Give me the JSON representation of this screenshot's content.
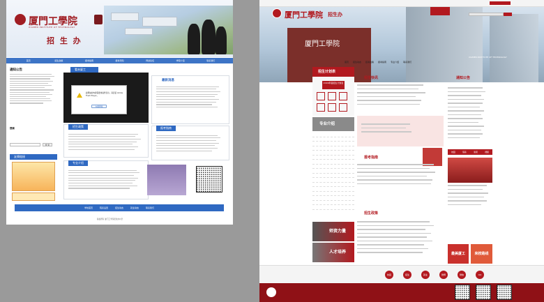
{
  "old_site": {
    "logo_text": "厦門工學院",
    "logo_english": "XIAMEN INSTITUTE OF TECHNOLOGY",
    "banner_subtitle": "招 生 办",
    "nav": [
      "首页",
      "招生政策",
      "报考指南",
      "报考须知",
      "师资队伍",
      "学院介绍",
      "联系我们"
    ],
    "notice_title": "通知公告",
    "featured_title": "最新消息",
    "campus_tab": "看未厦工",
    "dialog_text": "此网站的内容需要用插件显示，请安装 Adobe Flash Player。",
    "dialog_button": "立即安装",
    "search_label": "搜索",
    "search_button": "搜 索",
    "links_title": "友情链接",
    "policy_tab": "招生政策",
    "major_tab": "专业介绍",
    "guide_tab": "报考指南",
    "footer_links": [
      "学校首页",
      "院系设置",
      "招生动态",
      "就业动态",
      "联系我们"
    ],
    "copyright": "版权所有 厦门工学院招生办公室"
  },
  "new_site": {
    "logo_text": "厦門工學院",
    "logo_subtitle": "招生办",
    "hero_caption": "XIAMEN INSTITUTE OF TECHNOLOGY",
    "nav": [
      "首页",
      "招生动态",
      "招考政策",
      "报考指南",
      "专业介绍",
      "联系我们"
    ],
    "plan_title": "招生计划表",
    "plan_card": "2019年度招生计划表",
    "news_title": "招生快讯",
    "notice_title": "通知公告",
    "major_title": "专业介绍",
    "guide_title": "报考指南",
    "policy_title": "招生政策",
    "faculty_card": "师资力量",
    "talent_card": "人才培养",
    "right_tabs": [
      "校园",
      "院系",
      "新闻",
      "视频"
    ],
    "promo_cards": [
      "最美厦工",
      "来校路线"
    ],
    "footer_icons": [
      "校园",
      "招生",
      "就业",
      "微博",
      "微信",
      "QQ"
    ]
  },
  "colors": {
    "old_blue": "#2f69c2",
    "new_red": "#b2191f",
    "old_red": "#a01d23"
  }
}
